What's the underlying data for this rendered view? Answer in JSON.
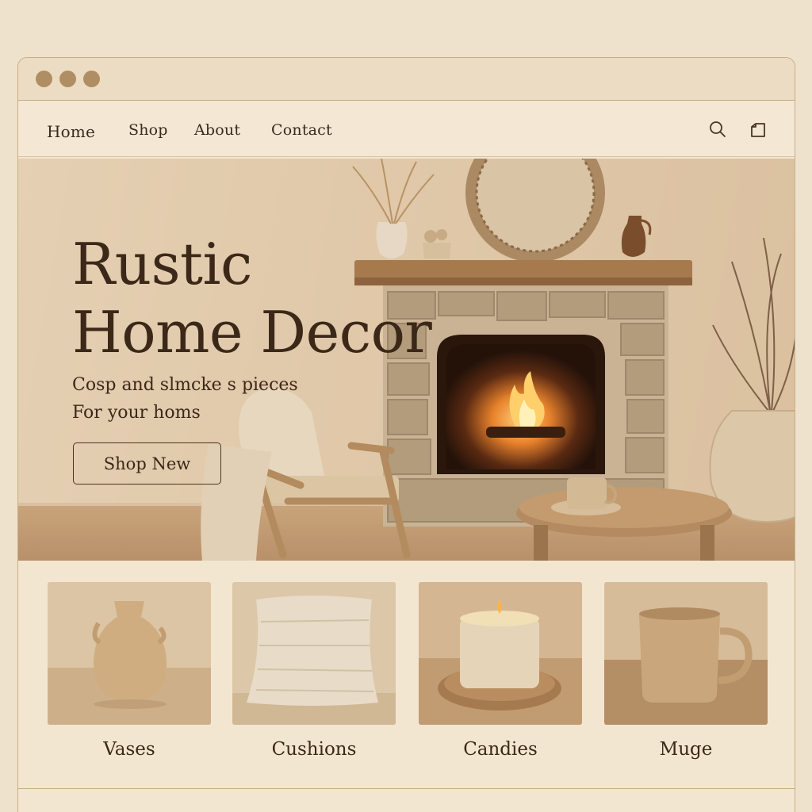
{
  "nav": {
    "links": [
      "Home",
      "Shop",
      "About",
      "Contact"
    ]
  },
  "icons": {
    "search": "search-icon",
    "cart": "shopping-bag-icon"
  },
  "hero": {
    "title_line1": "Rustic",
    "title_line2": "Home Decor",
    "subtitle_line1": "Cosp and slmcke s pieces",
    "subtitle_line2": "For your homs",
    "cta_label": "Shop New"
  },
  "products": [
    {
      "label": "Vases"
    },
    {
      "label": "Cushions"
    },
    {
      "label": "Candies"
    },
    {
      "label": "Muge"
    }
  ],
  "colors": {
    "background": "#efe2cc",
    "text": "#3b2818",
    "accent": "#b08e63",
    "border": "#c9ad86"
  }
}
